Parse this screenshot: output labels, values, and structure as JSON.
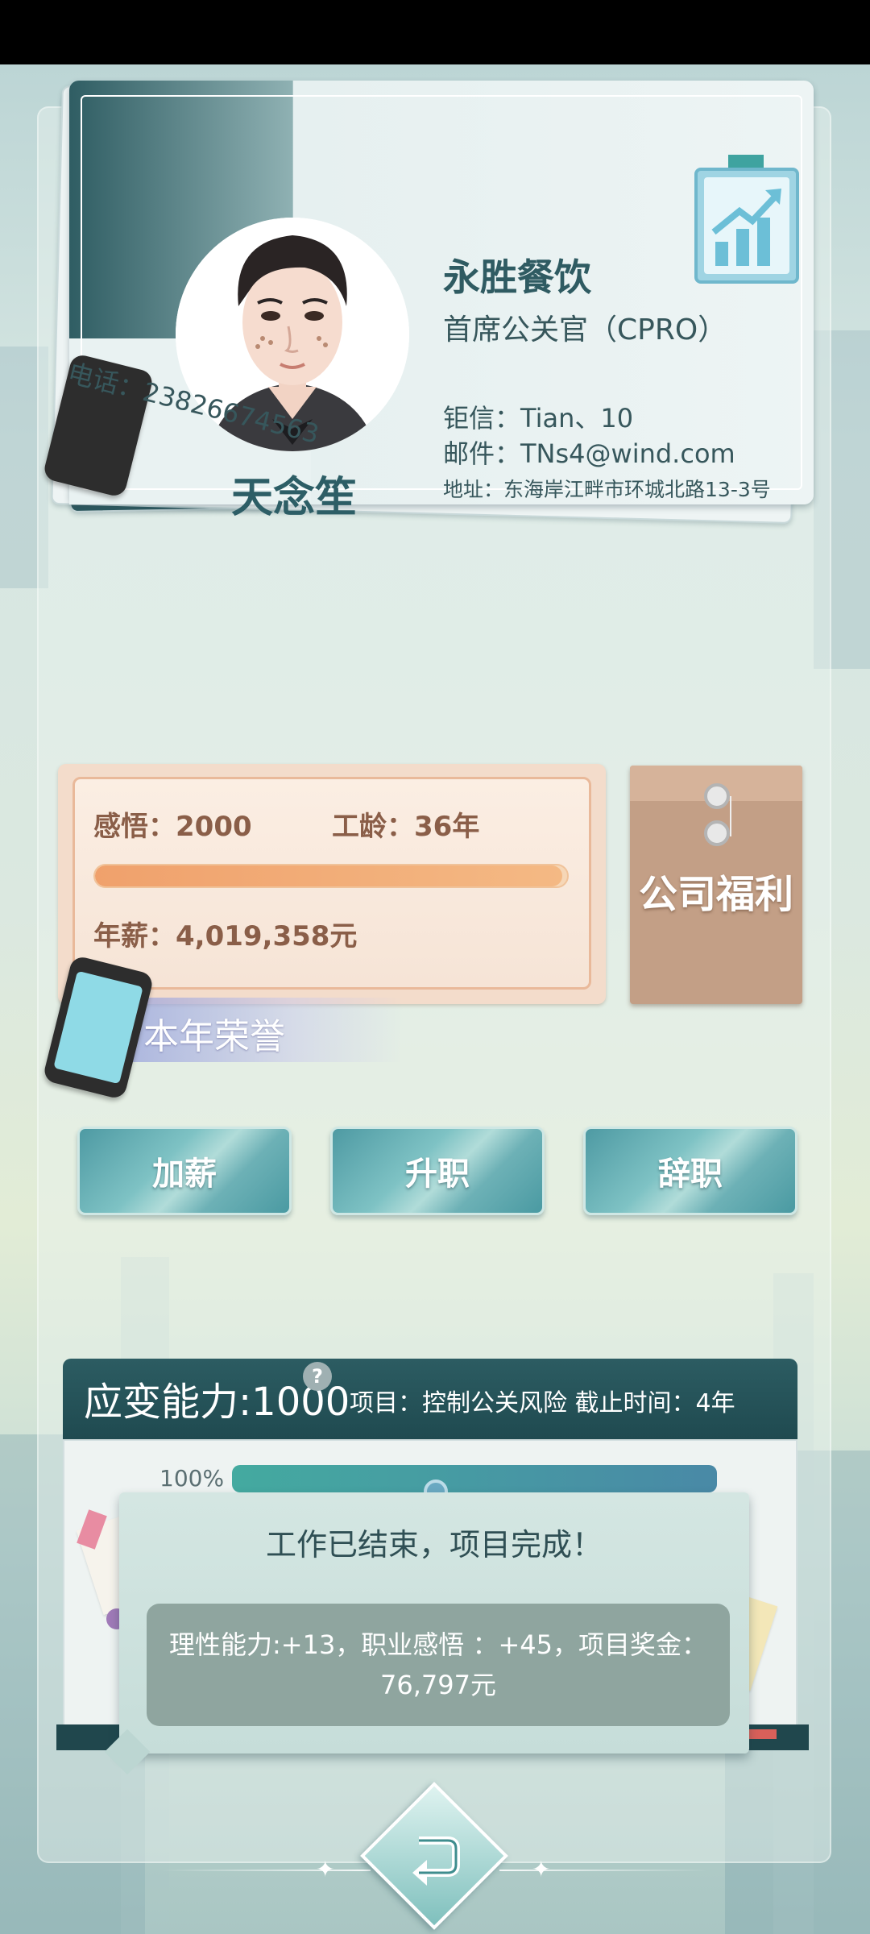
{
  "card": {
    "name": "天念笙",
    "company": "永胜餐饮",
    "title": "首席公关官（CPRO）",
    "phone": "电话：23826674563",
    "mail": "钜信：Tian、10",
    "email": "邮件：TNs4@wind.com",
    "address": "地址：东海岸江畔市环城北路13-3号"
  },
  "stats": {
    "insight": "感悟：2000",
    "years": "工龄：36年",
    "salary": "年薪：4,019,358元",
    "progress_fraction": 0.99
  },
  "welfare": {
    "label": "公司福利"
  },
  "honors": {
    "label": "本年荣誉"
  },
  "actions": {
    "raise": "加薪",
    "promote": "升职",
    "resign": "辞职"
  },
  "project": {
    "ability": "应变能力:1000",
    "info": "项目：控制公关风险   截止时间：4年",
    "help": "?",
    "percent_label": "100%",
    "percent_fraction": 1.0
  },
  "popup": {
    "title": "工作已结束，项目完成！",
    "result": "理性能力:+13，职业感悟 ：+45，项目奖金：76,797元"
  },
  "icons": {
    "back": "back-arrow-icon",
    "chart": "growth-chart-icon",
    "phone": "phone-icon"
  }
}
